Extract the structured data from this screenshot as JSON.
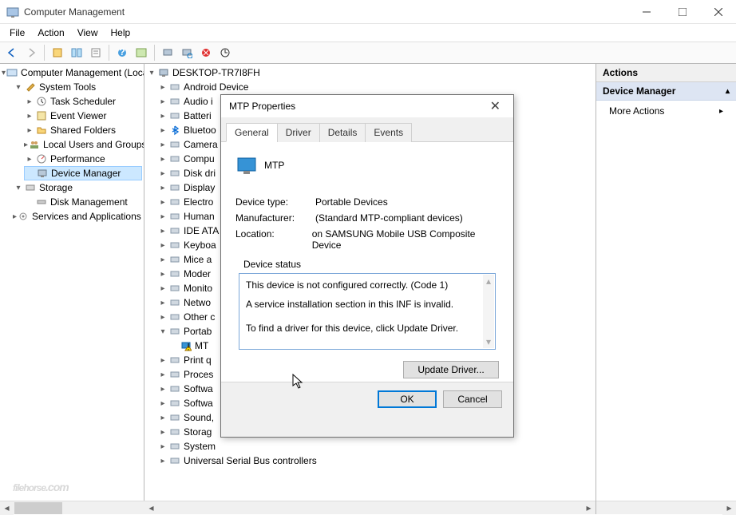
{
  "window": {
    "title": "Computer Management"
  },
  "menu": {
    "file": "File",
    "action": "Action",
    "view": "View",
    "help": "Help"
  },
  "left_tree": {
    "root": "Computer Management (Local",
    "system_tools": "System Tools",
    "task_scheduler": "Task Scheduler",
    "event_viewer": "Event Viewer",
    "shared_folders": "Shared Folders",
    "local_users": "Local Users and Groups",
    "performance": "Performance",
    "device_manager": "Device Manager",
    "storage": "Storage",
    "disk_management": "Disk Management",
    "services_apps": "Services and Applications"
  },
  "mid_tree": {
    "root": "DESKTOP-TR7I8FH",
    "items": [
      "Android Device",
      "Audio i",
      "Batteri",
      "Bluetoo",
      "Camera",
      "Compu",
      "Disk dri",
      "Display",
      "Electro",
      "Human",
      "IDE ATA",
      "Keyboa",
      "Mice a",
      "Moder",
      "Monito",
      "Netwo",
      "Other c",
      "Portab",
      "MT",
      "Print q",
      "Proces",
      "Softwa",
      "Softwa",
      "Sound,",
      "Storag",
      "System",
      "Universal Serial Bus controllers"
    ]
  },
  "actions": {
    "header": "Actions",
    "section": "Device Manager",
    "more": "More Actions"
  },
  "dialog": {
    "title": "MTP Properties",
    "tabs": {
      "general": "General",
      "driver": "Driver",
      "details": "Details",
      "events": "Events"
    },
    "device_name": "MTP",
    "fields": {
      "type_label": "Device type:",
      "type_value": "Portable Devices",
      "mfr_label": "Manufacturer:",
      "mfr_value": "(Standard MTP-compliant devices)",
      "loc_label": "Location:",
      "loc_value": "on SAMSUNG Mobile USB Composite Device"
    },
    "status_label": "Device status",
    "status_line1": "This device is not configured correctly. (Code 1)",
    "status_line2": "A service installation section in this INF is invalid.",
    "status_line3": "To find a driver for this device, click Update Driver.",
    "update_btn": "Update Driver...",
    "ok": "OK",
    "cancel": "Cancel"
  },
  "watermark": {
    "main": "filehorse",
    "suffix": ".com"
  }
}
